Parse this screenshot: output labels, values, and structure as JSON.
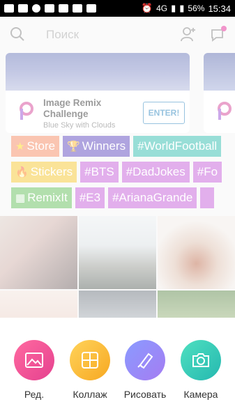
{
  "status_bar": {
    "network": "4G",
    "battery": "56%",
    "time": "15:34"
  },
  "header": {
    "search_placeholder": "Поиск"
  },
  "challenge": {
    "title": "Image Remix Challenge",
    "subtitle": "Blue Sky with Clouds",
    "button": "ENTER!"
  },
  "tags": {
    "row1": [
      {
        "glyph": "★",
        "label": "Store"
      },
      {
        "glyph": "🏆",
        "label": "Winners"
      },
      {
        "glyph": "",
        "label": "#WorldFootball"
      }
    ],
    "row2": [
      {
        "glyph": "🔥",
        "label": "Stickers"
      },
      {
        "glyph": "",
        "label": "#BTS"
      },
      {
        "glyph": "",
        "label": "#DadJokes"
      },
      {
        "glyph": "",
        "label": "#Fo"
      }
    ],
    "row3": [
      {
        "glyph": "▦",
        "label": "RemixIt"
      },
      {
        "glyph": "",
        "label": "#E3"
      },
      {
        "glyph": "",
        "label": "#ArianaGrande"
      }
    ]
  },
  "actions": [
    {
      "label": "Ред.",
      "icon": "image-edit-icon"
    },
    {
      "label": "Коллаж",
      "icon": "collage-grid-icon"
    },
    {
      "label": "Рисовать",
      "icon": "brush-icon"
    },
    {
      "label": "Камера",
      "icon": "camera-icon"
    }
  ]
}
